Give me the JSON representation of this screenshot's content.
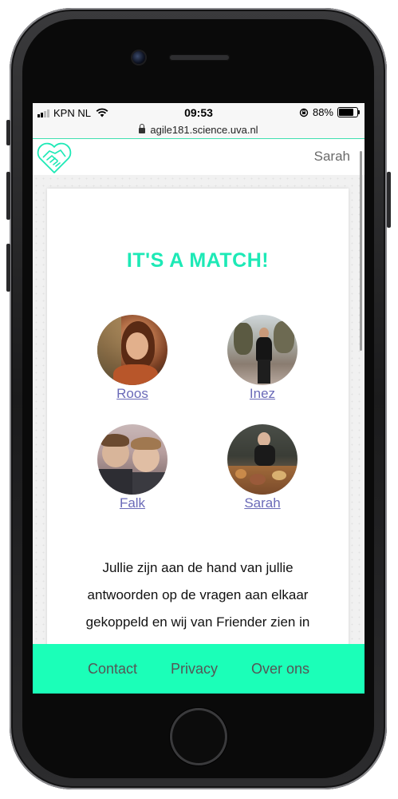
{
  "status": {
    "carrier": "KPN NL",
    "time": "09:53",
    "battery_percent": "88%",
    "battery_level": 0.88
  },
  "browser": {
    "url": "agile181.science.uva.nl"
  },
  "header": {
    "username": "Sarah"
  },
  "match": {
    "title": "IT'S A MATCH!",
    "members": [
      {
        "name": "Roos"
      },
      {
        "name": "Inez"
      },
      {
        "name": "Falk"
      },
      {
        "name": "Sarah"
      }
    ],
    "text": "Jullie zijn aan de hand van jullie antwoorden op de vragen aan elkaar gekoppeld en wij van Friender zien in"
  },
  "footer": {
    "links": [
      "Contact",
      "Privacy",
      "Over ons"
    ]
  },
  "colors": {
    "accent": "#1de9b6",
    "footer_bg": "#1bffb8",
    "link": "#6a6ab8"
  }
}
